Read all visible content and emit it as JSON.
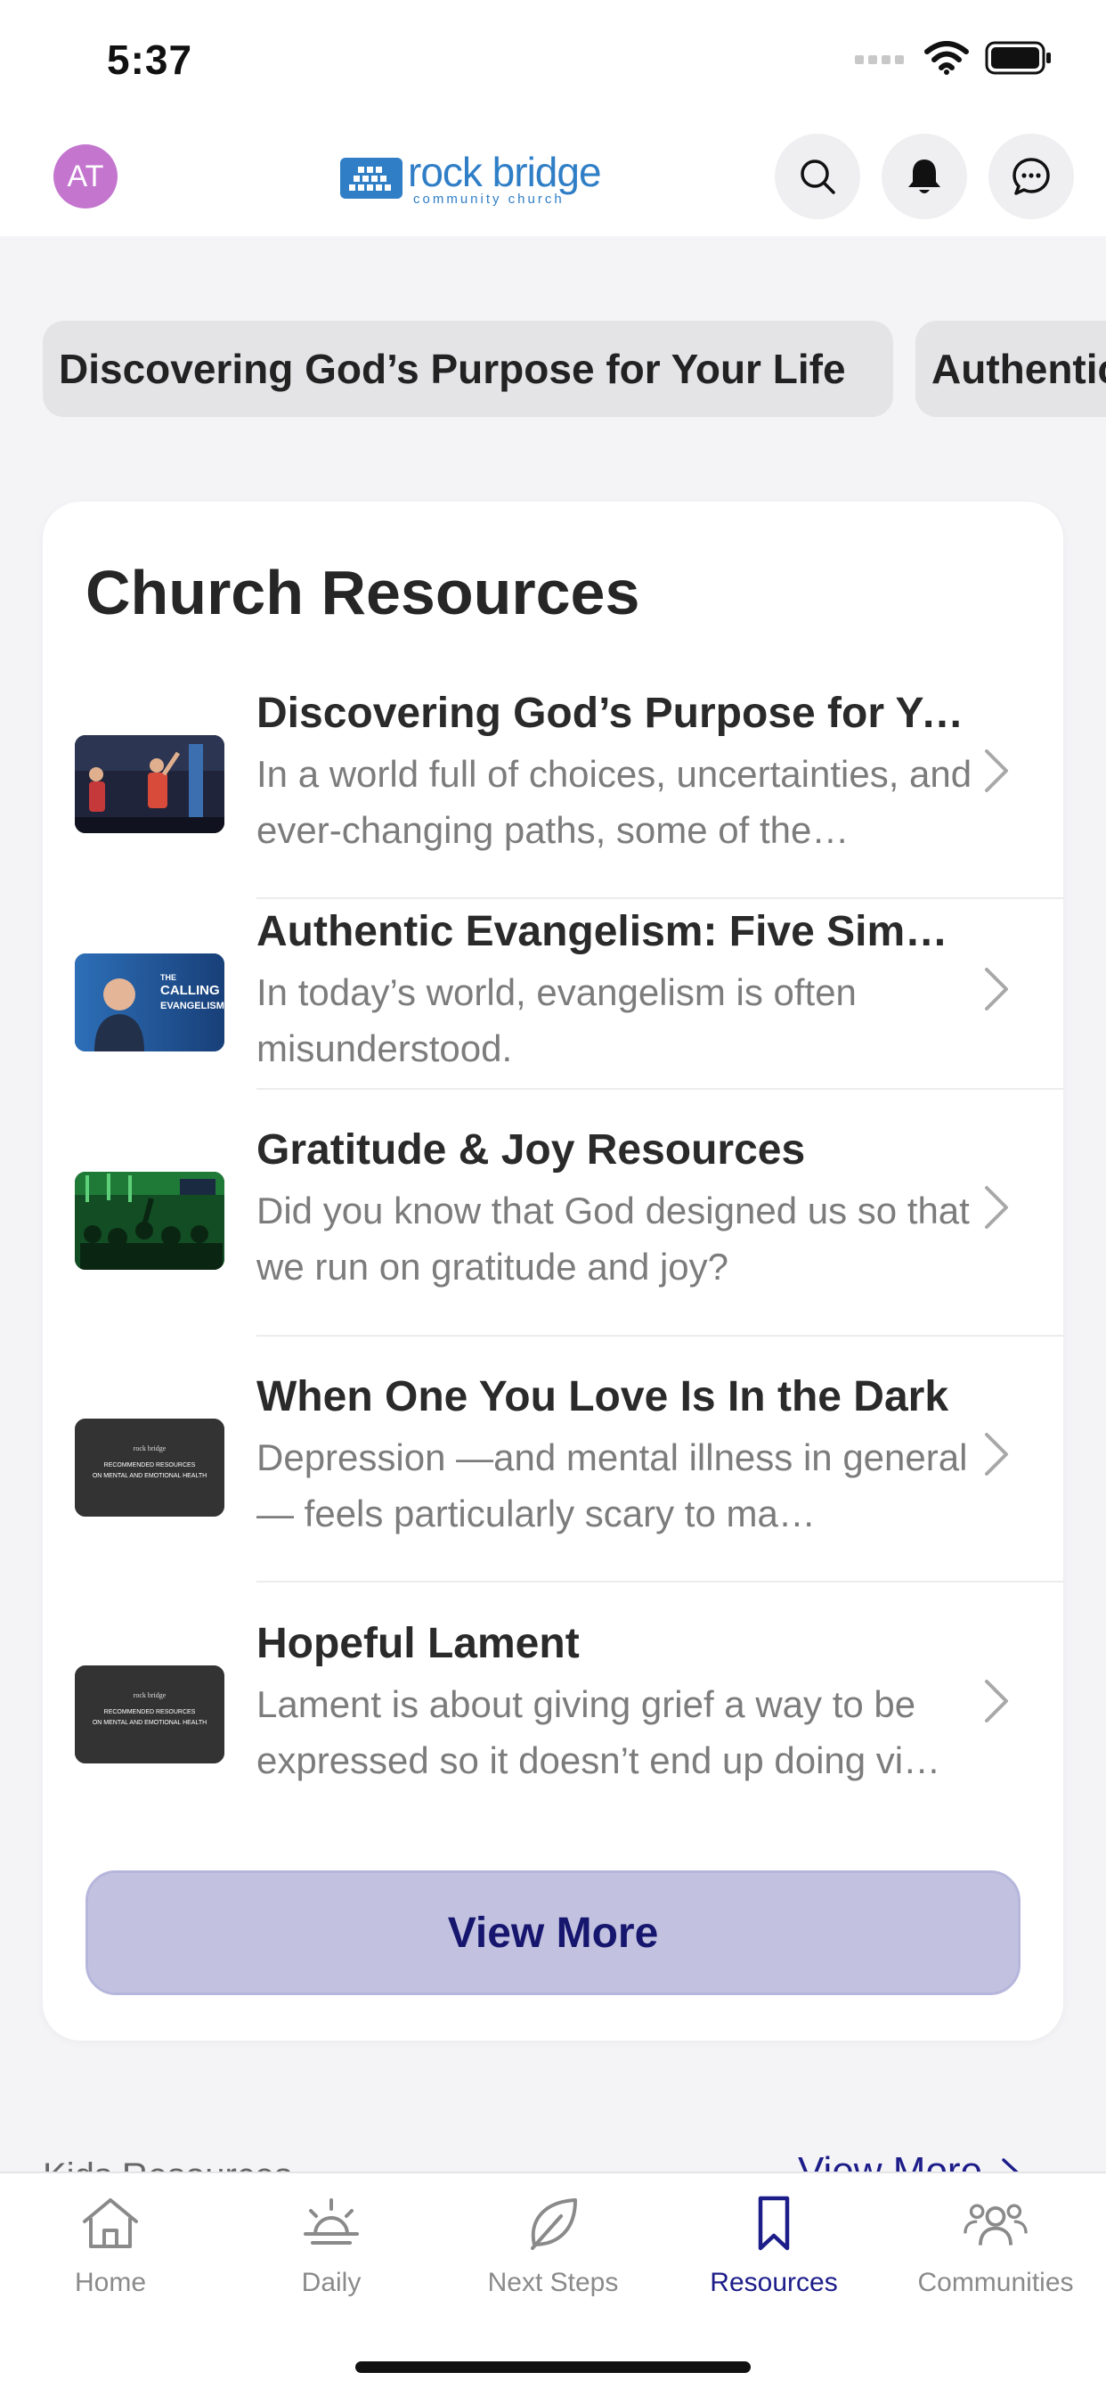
{
  "status_bar": {
    "time": "5:37"
  },
  "header": {
    "avatar_initials": "AT",
    "logo_main": "rock bridge",
    "logo_sub": "community church",
    "accent_color": "#2f7ec6",
    "buttons": [
      "search-icon",
      "bell-icon",
      "chat-icon"
    ]
  },
  "chips": [
    {
      "label": "Discovering God’s Purpose for Your Life"
    },
    {
      "label": "Authentic Evangelism: Five Simple Ways"
    }
  ],
  "resources": {
    "title": "Church Resources",
    "items": [
      {
        "title": "Discovering God’s Purpose for Your Life",
        "desc": " In a world full of choices, uncertainties, and ever-changing paths, some of the…",
        "thumb": "worship-stage"
      },
      {
        "title": "Authentic Evangelism: Five Simple Ways",
        "desc": " In today’s world, evangelism is often misunderstood.",
        "thumb": "calling-of-evangelism",
        "thumb_text_1": "THE",
        "thumb_text_2": "CALLING",
        "thumb_text_3": "EVANGELISM"
      },
      {
        "title": "Gratitude & Joy Resources",
        "desc": " Did you know that God designed us so that we run on gratitude and joy?",
        "thumb": "worship-crowd"
      },
      {
        "title": "When One You Love Is In the Dark",
        "desc": " Depression —and mental illness in general— feels particularly scary to ma…",
        "thumb": "recommended-resources",
        "thumb_text_1": "rock bridge",
        "thumb_text_2": "RECOMMENDED RESOURCES",
        "thumb_text_3": "ON MENTAL AND EMOTIONAL HEALTH"
      },
      {
        "title": "Hopeful Lament",
        "desc": " Lament is about giving grief a way to be expressed so it doesn’t end up doing vi…",
        "thumb": "recommended-resources",
        "thumb_text_1": "rock bridge",
        "thumb_text_2": "RECOMMENDED RESOURCES",
        "thumb_text_3": "ON MENTAL AND EMOTIONAL HEALTH"
      }
    ],
    "view_more_label": "View More",
    "button_color": "#c2c2e0"
  },
  "next_section": {
    "title": "Kids Resources",
    "view_more_label": "View More"
  },
  "tabbar": {
    "active_color": "#1d1d8a",
    "tabs": [
      {
        "label": "Home",
        "icon": "home-icon"
      },
      {
        "label": "Daily",
        "icon": "sunrise-icon"
      },
      {
        "label": "Next Steps",
        "icon": "leaf-icon"
      },
      {
        "label": "Resources",
        "icon": "bookmark-icon",
        "active": true
      },
      {
        "label": "Communities",
        "icon": "people-icon"
      }
    ]
  }
}
